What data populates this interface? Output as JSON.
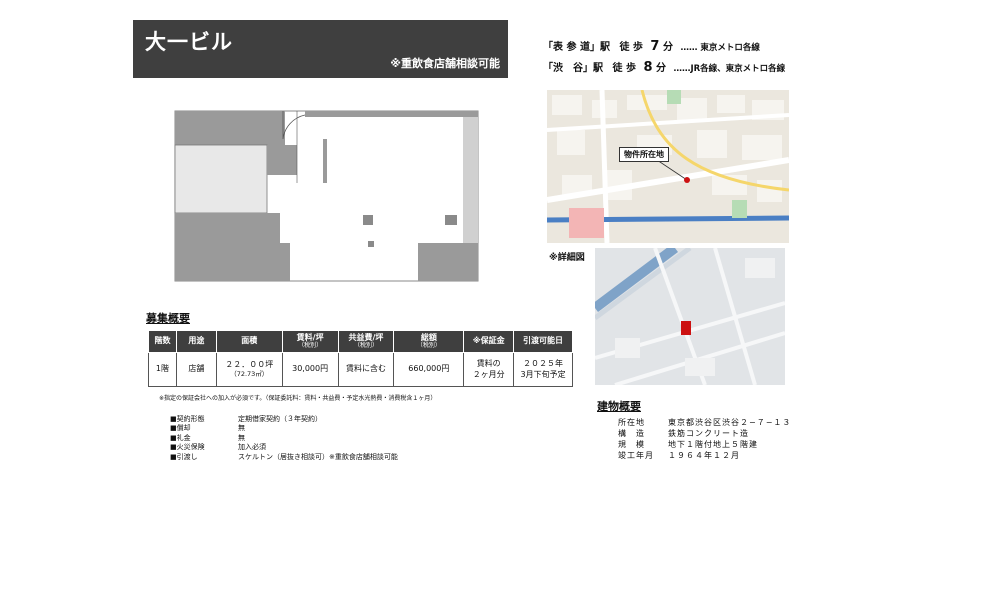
{
  "title": {
    "name": "大一ビル",
    "note": "※重飲食店舗相談可能"
  },
  "access": [
    {
      "station": "「表 参 道」駅",
      "walk": "徒 歩",
      "minutes": "7",
      "unit": "分",
      "lines": "…… 東京メトロ各線"
    },
    {
      "station": "「渋　谷」駅",
      "walk": "徒 歩",
      "minutes": "8",
      "unit": "分",
      "lines": "……JR各線、東京メトロ各線"
    }
  ],
  "map": {
    "marker_label": "物件所在地",
    "detail_label": "※詳細図"
  },
  "recruitment": {
    "title": "募集概要",
    "headers": [
      {
        "main": "階数",
        "sub": ""
      },
      {
        "main": "用途",
        "sub": ""
      },
      {
        "main": "面積",
        "sub": ""
      },
      {
        "main": "賃料/坪",
        "sub": "（税別）"
      },
      {
        "main": "共益費/坪",
        "sub": "（税別）"
      },
      {
        "main": "総額",
        "sub": "（税別）"
      },
      {
        "main": "※保証金",
        "sub": ""
      },
      {
        "main": "引渡可能日",
        "sub": ""
      }
    ],
    "row": {
      "floor": "1階",
      "use": "店舗",
      "area": "２２．００坪",
      "area_sub": "（72.73㎡）",
      "rent": "30,000円",
      "common": "賃料に含む",
      "total": "660,000円",
      "deposit": "賃料の",
      "deposit2": "２ヶ月分",
      "available": "２０２５年",
      "available2": "3月下旬予定"
    },
    "footnote": "※指定の保証会社への加入が必須です。（保証委託料：賃料・共益費・予定水光熱費・消費税含１ヶ月）"
  },
  "terms": [
    {
      "key": "■契約形態",
      "value": "定期借家契約（３年契約）"
    },
    {
      "key": "■償却",
      "value": "無"
    },
    {
      "key": "■礼金",
      "value": "無"
    },
    {
      "key": "■火災保険",
      "value": "加入必須"
    },
    {
      "key": "■引渡し",
      "value": "スケルトン（居抜き相談可）※重飲食店舗相談可能"
    }
  ],
  "building": {
    "title": "建物概要",
    "rows": [
      {
        "key": "所在地",
        "value": "東京都渋谷区渋谷２−７−１３"
      },
      {
        "key": "構　造",
        "value": "鉄筋コンクリート造"
      },
      {
        "key": "規　模",
        "value": "地下１階付地上５階建"
      },
      {
        "key": "竣工年月",
        "value": "１９６４年１２月"
      }
    ]
  },
  "colors": {
    "banner": "#3f3f3f",
    "marker": "#cc1111",
    "plan_fill": "#9a9a9a"
  }
}
